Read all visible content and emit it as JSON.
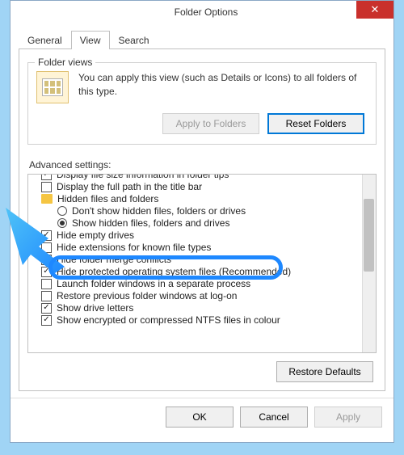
{
  "window": {
    "title": "Folder Options"
  },
  "tabs": {
    "general": "General",
    "view": "View",
    "search": "Search"
  },
  "folderViews": {
    "title": "Folder views",
    "text": "You can apply this view (such as Details or Icons) to all folders of this type.",
    "applyBtn": "Apply to Folders",
    "resetBtn": "Reset Folders"
  },
  "advanced": {
    "label": "Advanced settings:",
    "items": [
      {
        "type": "check",
        "checked": true,
        "label": "Display file size information in folder tips"
      },
      {
        "type": "check",
        "checked": false,
        "label": "Display the full path in the title bar"
      },
      {
        "type": "header",
        "label": "Hidden files and folders"
      },
      {
        "type": "radio",
        "checked": false,
        "label": "Don't show hidden files, folders or drives"
      },
      {
        "type": "radio",
        "checked": true,
        "label": "Show hidden files, folders and drives"
      },
      {
        "type": "check",
        "checked": true,
        "label": "Hide empty drives"
      },
      {
        "type": "check",
        "checked": false,
        "label": "Hide extensions for known file types",
        "highlight": true
      },
      {
        "type": "check",
        "checked": true,
        "label": "Hide folder merge conflicts"
      },
      {
        "type": "check",
        "checked": true,
        "label": "Hide protected operating system files (Recommended)"
      },
      {
        "type": "check",
        "checked": false,
        "label": "Launch folder windows in a separate process"
      },
      {
        "type": "check",
        "checked": false,
        "label": "Restore previous folder windows at log-on"
      },
      {
        "type": "check",
        "checked": true,
        "label": "Show drive letters"
      },
      {
        "type": "check",
        "checked": true,
        "label": "Show encrypted or compressed NTFS files in colour"
      }
    ],
    "restoreBtn": "Restore Defaults"
  },
  "buttons": {
    "ok": "OK",
    "cancel": "Cancel",
    "apply": "Apply"
  }
}
